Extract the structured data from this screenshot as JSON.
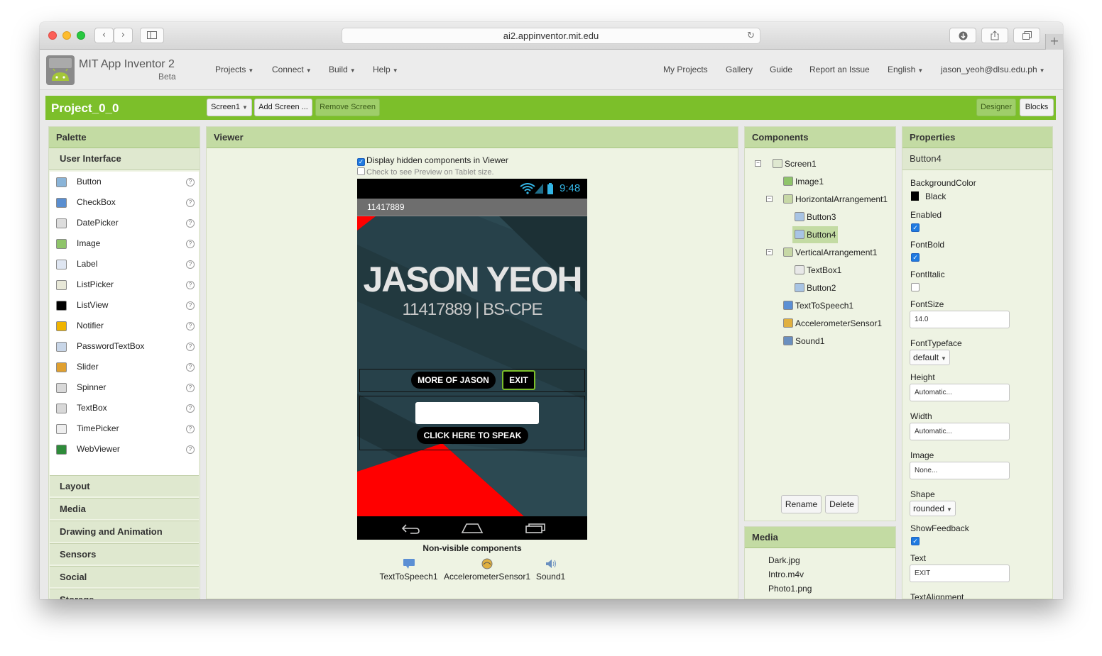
{
  "browser": {
    "url": "ai2.appinventor.mit.edu",
    "back_icon": "chevron-left",
    "forward_icon": "chevron-right",
    "sidebar_icon": "sidebar",
    "download_icon": "download",
    "share_icon": "share",
    "tabs_icon": "tabs",
    "newtab_label": "+"
  },
  "app": {
    "brand_title": "MIT App Inventor 2",
    "brand_sub": "Beta",
    "nav_left": [
      "Projects",
      "Connect",
      "Build",
      "Help"
    ],
    "nav_right": [
      "My Projects",
      "Gallery",
      "Guide",
      "Report an Issue"
    ],
    "language": "English",
    "user": "jason_yeoh@dlsu.edu.ph"
  },
  "project": {
    "name": "Project_0_0",
    "screen_select": "Screen1",
    "add_screen": "Add Screen ...",
    "remove_screen": "Remove Screen",
    "designer": "Designer",
    "blocks": "Blocks"
  },
  "palette": {
    "title": "Palette",
    "category_open": "User Interface",
    "items": [
      {
        "label": "Button",
        "icon": "button-icon"
      },
      {
        "label": "CheckBox",
        "icon": "checkbox-icon"
      },
      {
        "label": "DatePicker",
        "icon": "datepicker-icon"
      },
      {
        "label": "Image",
        "icon": "image-icon"
      },
      {
        "label": "Label",
        "icon": "label-icon"
      },
      {
        "label": "ListPicker",
        "icon": "listpicker-icon"
      },
      {
        "label": "ListView",
        "icon": "listview-icon"
      },
      {
        "label": "Notifier",
        "icon": "notifier-icon"
      },
      {
        "label": "PasswordTextBox",
        "icon": "password-icon"
      },
      {
        "label": "Slider",
        "icon": "slider-icon"
      },
      {
        "label": "Spinner",
        "icon": "spinner-icon"
      },
      {
        "label": "TextBox",
        "icon": "textbox-icon"
      },
      {
        "label": "TimePicker",
        "icon": "timepicker-icon"
      },
      {
        "label": "WebViewer",
        "icon": "webviewer-icon"
      }
    ],
    "help_glyph": "?",
    "categories": [
      "Layout",
      "Media",
      "Drawing and Animation",
      "Sensors",
      "Social",
      "Storage"
    ]
  },
  "viewer": {
    "title": "Viewer",
    "display_hidden": "Display hidden components in Viewer",
    "tablet_preview": "Check to see Preview on Tablet size.",
    "phone": {
      "clock": "9:48",
      "title": "11417889",
      "name_text": "JASON YEOH",
      "id_text": "11417889 | BS-CPE",
      "btn_more": "MORE OF JASON",
      "btn_exit": "EXIT",
      "btn_speak": "CLICK HERE TO SPEAK"
    },
    "nonvisible_title": "Non-visible components",
    "nonvisible": [
      {
        "label": "TextToSpeech1",
        "icon": "speech-icon"
      },
      {
        "label": "AccelerometerSensor1",
        "icon": "accelerometer-icon"
      },
      {
        "label": "Sound1",
        "icon": "sound-icon"
      }
    ]
  },
  "components": {
    "title": "Components",
    "tree": [
      {
        "label": "Screen1",
        "level": 0,
        "toggle": "⊟"
      },
      {
        "label": "Image1",
        "level": 1,
        "toggle": ""
      },
      {
        "label": "HorizontalArrangement1",
        "level": 1,
        "toggle": "⊟"
      },
      {
        "label": "Button3",
        "level": 2,
        "toggle": ""
      },
      {
        "label": "Button4",
        "level": 2,
        "toggle": "",
        "selected": true
      },
      {
        "label": "VerticalArrangement1",
        "level": 1,
        "toggle": "⊟"
      },
      {
        "label": "TextBox1",
        "level": 2,
        "toggle": ""
      },
      {
        "label": "Button2",
        "level": 2,
        "toggle": ""
      },
      {
        "label": "TextToSpeech1",
        "level": 1,
        "toggle": ""
      },
      {
        "label": "AccelerometerSensor1",
        "level": 1,
        "toggle": ""
      },
      {
        "label": "Sound1",
        "level": 1,
        "toggle": ""
      }
    ],
    "rename": "Rename",
    "delete": "Delete"
  },
  "media": {
    "title": "Media",
    "files": [
      "Dark.jpg",
      "Intro.m4v",
      "Photo1.png"
    ]
  },
  "properties": {
    "title": "Properties",
    "component": "Button4",
    "background_color_label": "BackgroundColor",
    "background_color_value": "Black",
    "enabled_label": "Enabled",
    "enabled": true,
    "fontbold_label": "FontBold",
    "fontbold": true,
    "fontitalic_label": "FontItalic",
    "fontitalic": false,
    "fontsize_label": "FontSize",
    "fontsize_value": "14.0",
    "fonttypeface_label": "FontTypeface",
    "fonttypeface_value": "default",
    "height_label": "Height",
    "height_value": "Automatic...",
    "width_label": "Width",
    "width_value": "Automatic...",
    "image_label": "Image",
    "image_value": "None...",
    "shape_label": "Shape",
    "shape_value": "rounded",
    "showfeedback_label": "ShowFeedback",
    "showfeedback": true,
    "text_label": "Text",
    "text_value": "EXIT",
    "textalignment_label": "TextAlignment"
  },
  "colors": {
    "green_bar": "#7cbf2a",
    "panel_header": "#c3dba3",
    "panel_bg": "#eef3e3",
    "selected_row": "#c3dba3",
    "phone_bg": "#27414a",
    "red_accent": "#ff0000"
  }
}
